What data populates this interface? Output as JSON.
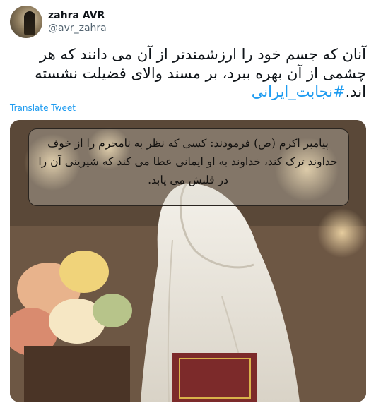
{
  "user": {
    "display_name": "zahra AVR",
    "handle": "@avr_zahra"
  },
  "tweet": {
    "text_main": "آنان که جسم خود را ارزشمندتر از آن می دانند که هر چشمی از آن بهره ببرد، بر مسند والای فضیلت نشسته اند.",
    "hashtag": "#نجابت_ایرانی",
    "translate_label": "Translate Tweet"
  },
  "media": {
    "caption": "پیامبر اکرم (ص) فرمودند: کسی که نظر به نامحرم را از خوف خداوند ترک کند، خداوند به او ایمانی عطا می کند که شیرینی آن را در قلبش می یابد."
  },
  "colors": {
    "link": "#1d9bf0",
    "text": "#0f1419",
    "secondary": "#536471"
  }
}
